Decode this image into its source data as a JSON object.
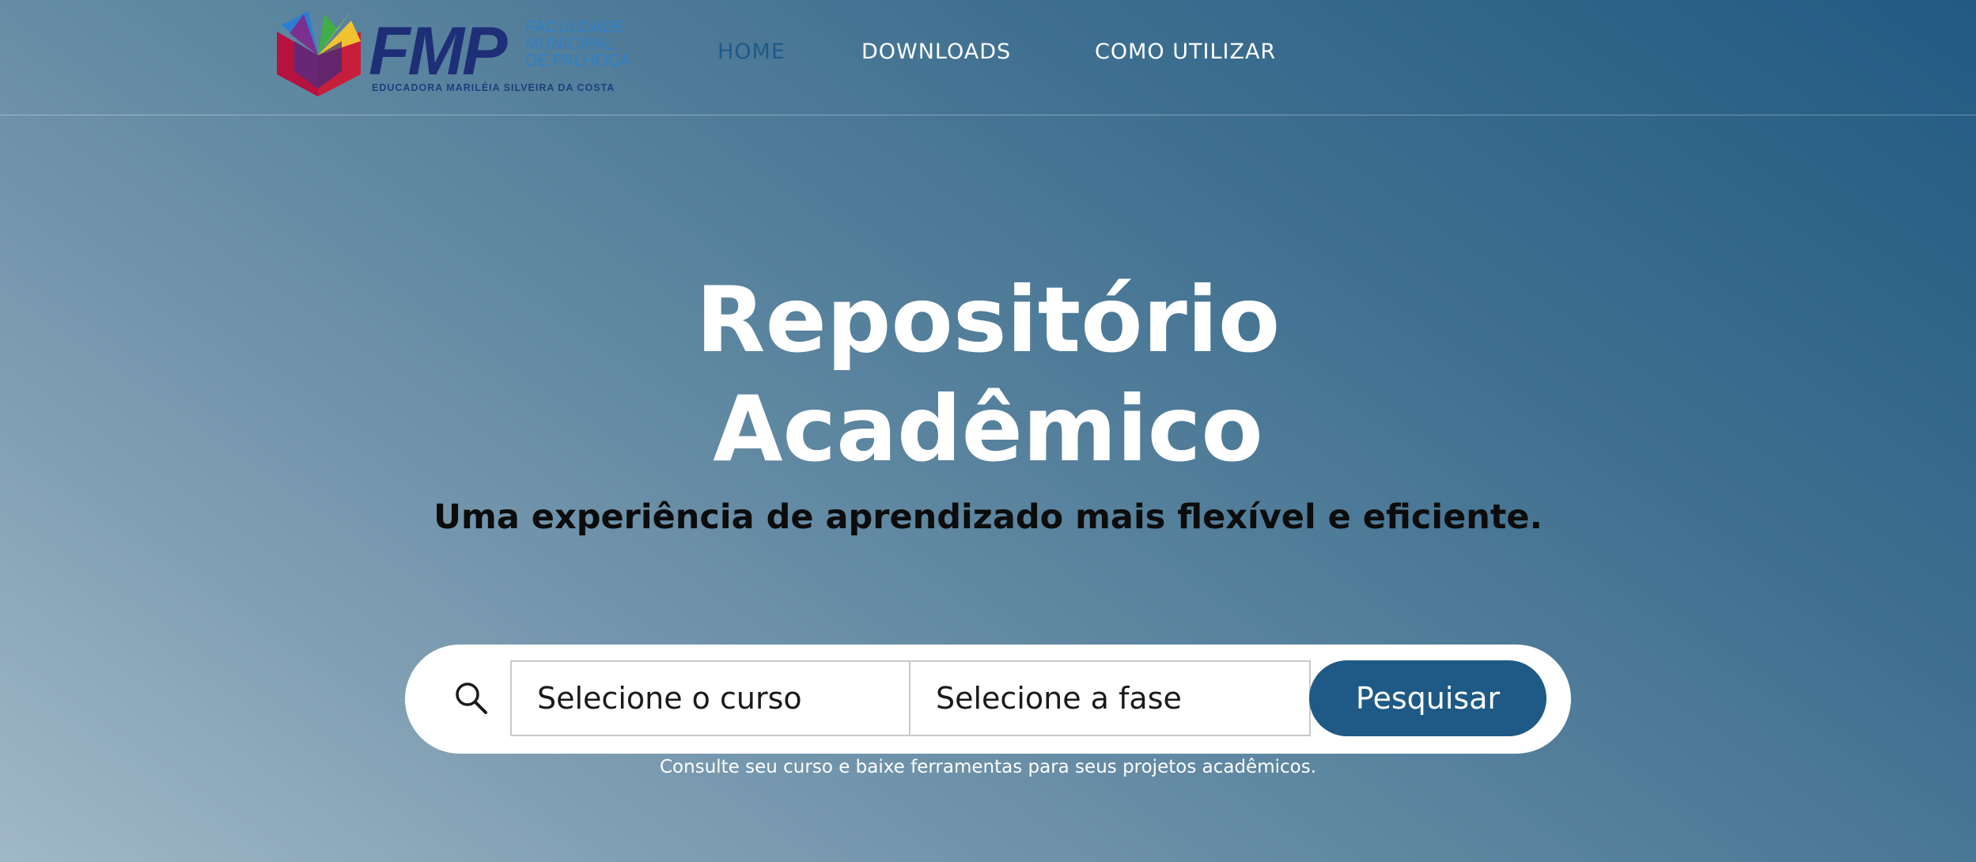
{
  "header": {
    "logo": {
      "name": "FMP",
      "side_lines": [
        "FACULDADE",
        "MUNICIPAL",
        "DE PALHOÇA"
      ],
      "subtitle": "EDUCADORA MARILÉIA SILVEIRA DA COSTA",
      "icon": "colored-book-logo-icon"
    },
    "nav": [
      {
        "label": "HOME",
        "active": true
      },
      {
        "label": "DOWNLOADS",
        "active": false
      },
      {
        "label": "COMO UTILIZAR",
        "active": false
      }
    ]
  },
  "hero": {
    "title_line1": "Repositório",
    "title_line2": "Acadêmico",
    "subtitle": "Uma experiência de aprendizado mais flexível e eficiente."
  },
  "search": {
    "icon": "search-icon",
    "course_select": "Selecione o curso",
    "phase_select": "Selecione a fase",
    "button_label": "Pesquisar",
    "hint": "Consulte seu curso e baixe ferramentas para seus projetos acadêmicos."
  },
  "colors": {
    "active_nav": "#1f5a86",
    "button": "#1e5a85",
    "logo_text": "#1e2f78",
    "logo_side_text": "#2f7fc9"
  }
}
